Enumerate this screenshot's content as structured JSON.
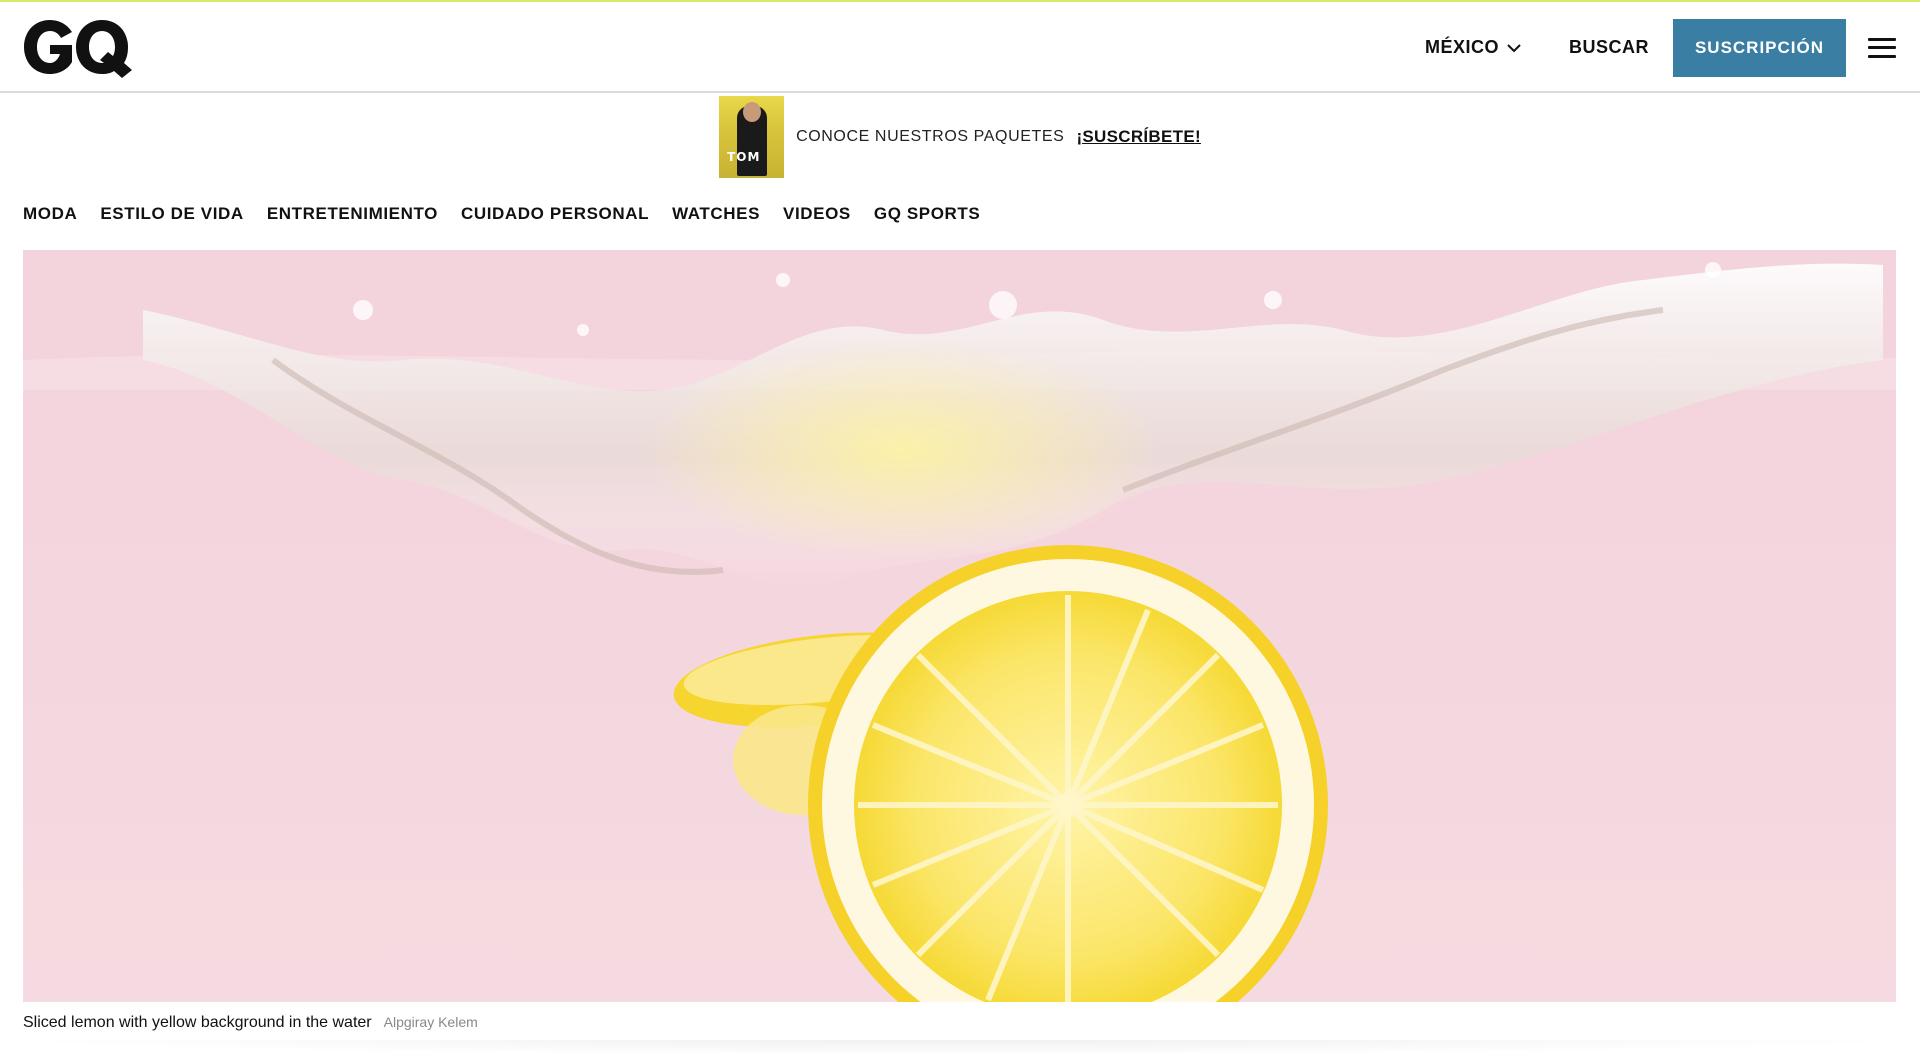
{
  "header": {
    "logo_alt": "GQ",
    "country": "MÉXICO",
    "search_label": "BUSCAR",
    "subscribe_label": "SUSCRIPCIÓN",
    "accent_color": "#3a7ea3"
  },
  "promo": {
    "cover_text": "TOM",
    "text": "CONOCE NUESTROS PAQUETES",
    "link": "¡SUSCRÍBETE!"
  },
  "categories": [
    "MODA",
    "ESTILO DE VIDA",
    "ENTRETENIMIENTO",
    "CUIDADO PERSONAL",
    "WATCHES",
    "VIDEOS",
    "GQ SPORTS"
  ],
  "hero": {
    "caption": "Sliced lemon with yellow background in the water",
    "credit": "Alpgiray Kelem"
  },
  "icons": [
    "gq-logo",
    "chevron-down-icon",
    "menu-icon"
  ]
}
